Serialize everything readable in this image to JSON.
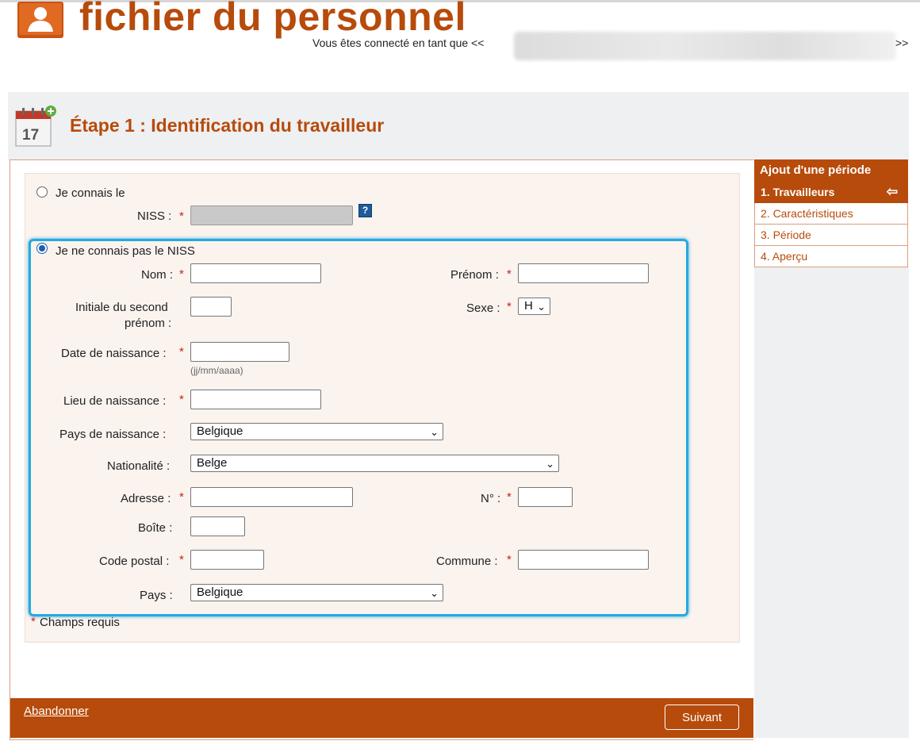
{
  "header": {
    "app_title": "fichier du personnel",
    "connected_prefix": "Vous êtes connecté en tant que <<",
    "connected_suffix": ">>"
  },
  "step": {
    "title": "Étape 1 : Identification du travailleur"
  },
  "form": {
    "option_known": "Je connais le",
    "niss_label": "NISS :",
    "help": "?",
    "option_unknown": "Je ne connais pas le NISS",
    "nom_label": "Nom :",
    "prenom_label": "Prénom :",
    "initiale_label_1": "Initiale du second",
    "initiale_label_2": "prénom :",
    "sexe_label": "Sexe :",
    "sexe_value": "H",
    "date_label": "Date de naissance :",
    "date_hint": "(jj/mm/aaaa)",
    "lieu_label": "Lieu de naissance :",
    "pays_naissance_label": "Pays de naissance :",
    "pays_naissance_value": "Belgique",
    "nationalite_label": "Nationalité :",
    "nationalite_value": "Belge",
    "adresse_label": "Adresse :",
    "numero_label": "N° :",
    "boite_label": "Boîte :",
    "code_postal_label": "Code postal :",
    "commune_label": "Commune :",
    "pays_label": "Pays :",
    "pays_value": "Belgique",
    "required_mark": "*",
    "required_note": "Champs requis"
  },
  "footer": {
    "abandon": "Abandonner",
    "next": "Suivant"
  },
  "sidebar": {
    "title": "Ajout d'une période",
    "items": [
      {
        "label": "1. Travailleurs",
        "active": true
      },
      {
        "label": "2. Caractéristiques"
      },
      {
        "label": "3. Période"
      },
      {
        "label": "4. Aperçu"
      }
    ]
  },
  "colors": {
    "brand": "#b74b0b",
    "highlight": "#26a9e0",
    "required": "#cc1e1e"
  }
}
